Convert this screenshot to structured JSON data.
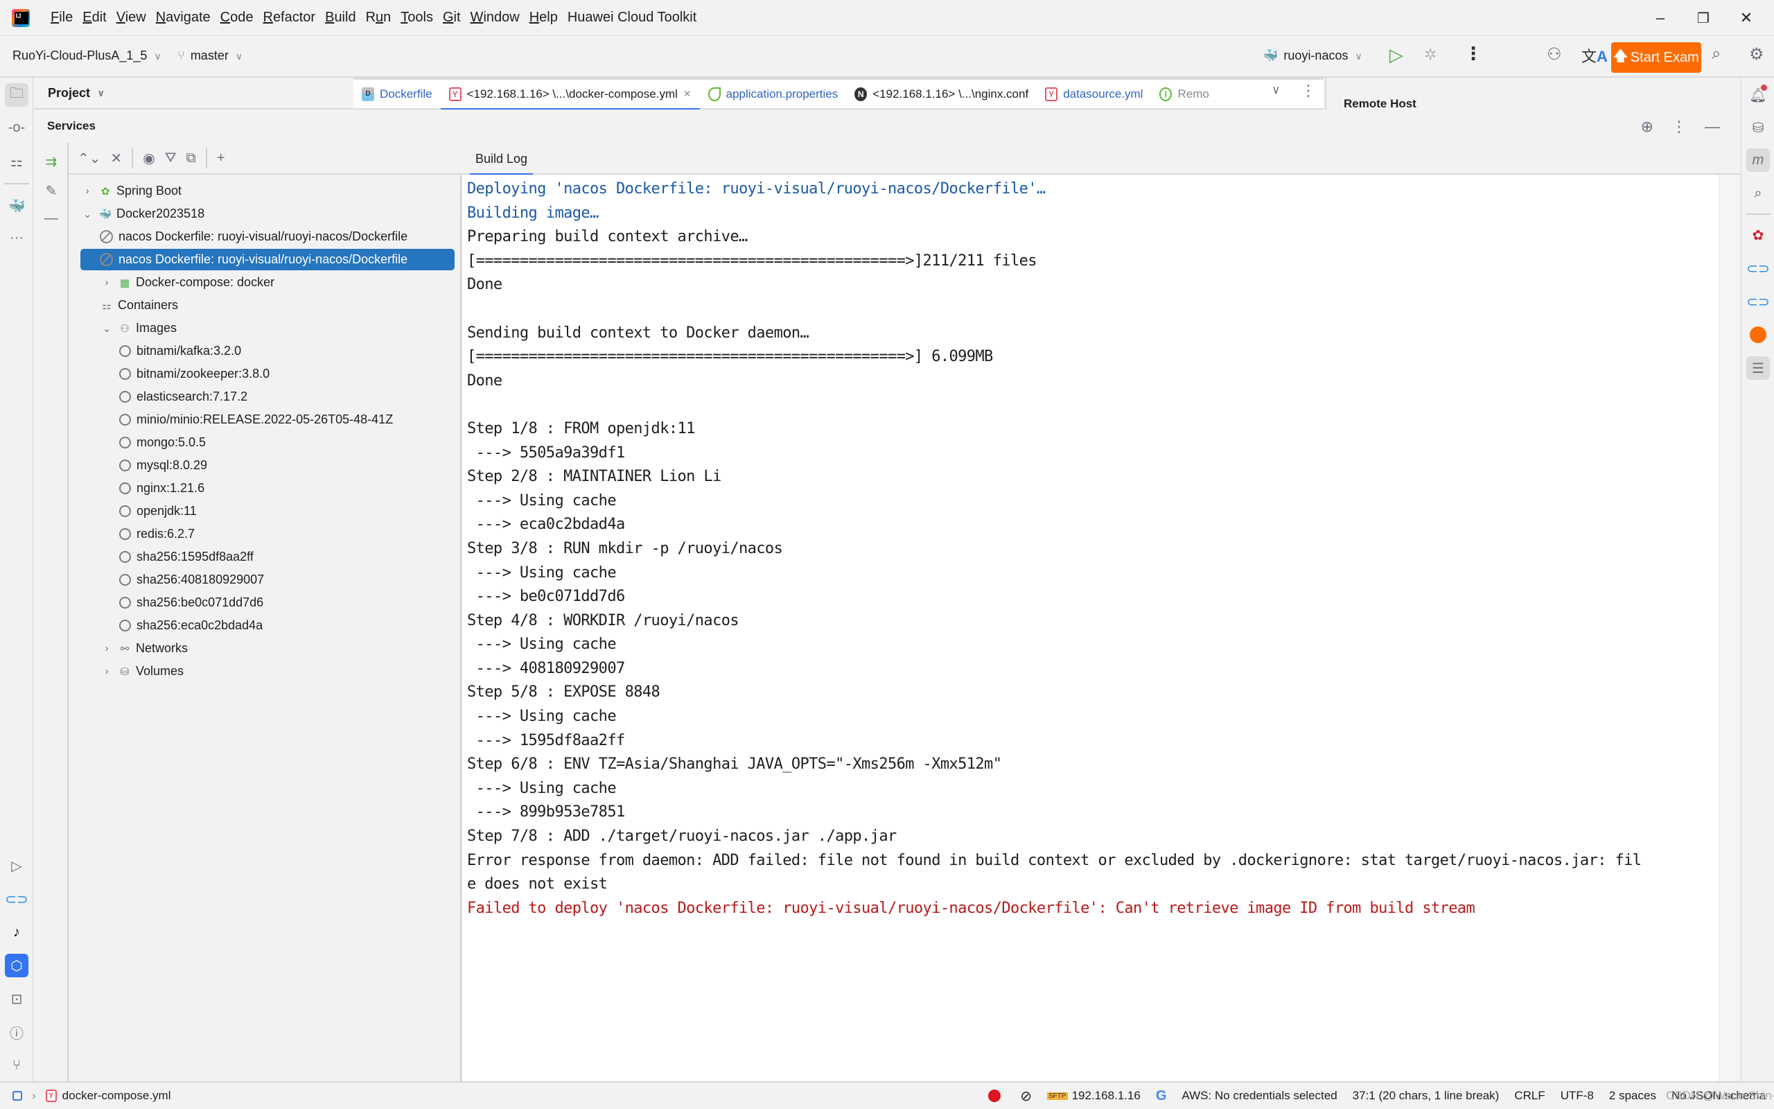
{
  "menu": {
    "items": [
      {
        "label": "File",
        "mnemonic": "F",
        "rest": "ile"
      },
      {
        "label": "Edit",
        "mnemonic": "E",
        "rest": "dit"
      },
      {
        "label": "View",
        "mnemonic": "V",
        "rest": "iew"
      },
      {
        "label": "Navigate",
        "mnemonic": "N",
        "rest": "avigate"
      },
      {
        "label": "Code",
        "mnemonic": "C",
        "rest": "ode"
      },
      {
        "label": "Refactor",
        "mnemonic": "R",
        "rest": "efactor"
      },
      {
        "label": "Build",
        "mnemonic": "B",
        "rest": "uild"
      },
      {
        "label": "Run",
        "mnemonic": "R",
        "rest": "un",
        "pre": "R",
        "u": "u",
        "post": "n"
      },
      {
        "label": "Tools",
        "mnemonic": "T",
        "rest": "ools"
      },
      {
        "label": "Git",
        "mnemonic": "G",
        "rest": "it"
      },
      {
        "label": "Window",
        "mnemonic": "W",
        "rest": "indow"
      },
      {
        "label": "Help",
        "mnemonic": "H",
        "rest": "elp"
      },
      {
        "label": "Huawei Cloud Toolkit",
        "mnemonic": "",
        "rest": "Huawei Cloud Toolkit"
      }
    ],
    "window_controls": {
      "minimize": "–",
      "restore": "❐",
      "close": "✕"
    }
  },
  "toolbar": {
    "project_name": "RuoYi-Cloud-PlusA_1_5",
    "branch": "master",
    "run_config": "ruoyi-nacos",
    "start_exam_label": "Start Exam",
    "colors": {
      "start_exam": "#fb6d04",
      "run": "#4fa94d"
    }
  },
  "project_panel": {
    "title": "Project"
  },
  "editor_tabs": [
    {
      "label": "Dockerfile",
      "icon": "dockerfile-icon",
      "active": false
    },
    {
      "label": "<192.168.1.16> \\...\\docker-compose.yml",
      "icon": "yaml-icon",
      "active": true,
      "closable": true
    },
    {
      "label": "application.properties",
      "icon": "spring-icon",
      "active": false
    },
    {
      "label": "<192.168.1.16> \\...\\nginx.conf",
      "icon": "nginx-icon",
      "active": false
    },
    {
      "label": "datasource.yml",
      "icon": "yaml-icon",
      "active": false
    },
    {
      "label": "Remo",
      "icon": "remote-icon",
      "active": false
    }
  ],
  "remote_host_panel": {
    "title": "Remote Host"
  },
  "services": {
    "title": "Services",
    "log_tab": "Build Log",
    "tree": [
      {
        "label": "Spring Boot",
        "level": 0,
        "expand": "collapsed",
        "icon": "spring-boot-icon"
      },
      {
        "label": "Docker2023518",
        "level": 0,
        "expand": "expanded",
        "icon": "docker-icon"
      },
      {
        "label": "nacos Dockerfile: ruoyi-visual/ruoyi-nacos/Dockerfile",
        "level": 1,
        "expand": "none",
        "icon": "stopped-icon"
      },
      {
        "label": "nacos Dockerfile: ruoyi-visual/ruoyi-nacos/Dockerfile",
        "level": 1,
        "expand": "none",
        "icon": "stopped-icon",
        "selected": true
      },
      {
        "label": "Docker-compose: docker",
        "level": 1,
        "expand": "collapsed",
        "icon": "compose-icon"
      },
      {
        "label": "Containers",
        "level": 1,
        "expand": "none",
        "icon": "containers-icon"
      },
      {
        "label": "Images",
        "level": 1,
        "expand": "expanded",
        "icon": "images-icon"
      },
      {
        "label": "bitnami/kafka:3.2.0",
        "level": 2,
        "expand": "none",
        "icon": "image-icon"
      },
      {
        "label": "bitnami/zookeeper:3.8.0",
        "level": 2,
        "expand": "none",
        "icon": "image-icon"
      },
      {
        "label": "elasticsearch:7.17.2",
        "level": 2,
        "expand": "none",
        "icon": "image-icon"
      },
      {
        "label": "minio/minio:RELEASE.2022-05-26T05-48-41Z",
        "level": 2,
        "expand": "none",
        "icon": "image-icon"
      },
      {
        "label": "mongo:5.0.5",
        "level": 2,
        "expand": "none",
        "icon": "image-icon"
      },
      {
        "label": "mysql:8.0.29",
        "level": 2,
        "expand": "none",
        "icon": "image-icon"
      },
      {
        "label": "nginx:1.21.6",
        "level": 2,
        "expand": "none",
        "icon": "image-icon"
      },
      {
        "label": "openjdk:11",
        "level": 2,
        "expand": "none",
        "icon": "image-icon"
      },
      {
        "label": "redis:6.2.7",
        "level": 2,
        "expand": "none",
        "icon": "image-icon"
      },
      {
        "label": "sha256:1595df8aa2ff",
        "level": 2,
        "expand": "none",
        "icon": "image-icon"
      },
      {
        "label": "sha256:408180929007",
        "level": 2,
        "expand": "none",
        "icon": "image-icon"
      },
      {
        "label": "sha256:be0c071dd7d6",
        "level": 2,
        "expand": "none",
        "icon": "image-icon"
      },
      {
        "label": "sha256:eca0c2bdad4a",
        "level": 2,
        "expand": "none",
        "icon": "image-icon"
      },
      {
        "label": "Networks",
        "level": 1,
        "expand": "collapsed",
        "icon": "networks-icon"
      },
      {
        "label": "Volumes",
        "level": 1,
        "expand": "collapsed",
        "icon": "volumes-icon"
      }
    ]
  },
  "build_log": [
    {
      "text": "Deploying 'nacos Dockerfile: ruoyi-visual/ruoyi-nacos/Dockerfile'…",
      "kind": "info"
    },
    {
      "text": "Building image…",
      "kind": "info"
    },
    {
      "text": "Preparing build context archive…",
      "kind": "normal"
    },
    {
      "text": "[=================================================>]211/211 files",
      "kind": "normal"
    },
    {
      "text": "Done",
      "kind": "normal"
    },
    {
      "text": "",
      "kind": "normal"
    },
    {
      "text": "Sending build context to Docker daemon…",
      "kind": "normal"
    },
    {
      "text": "[=================================================>] 6.099MB",
      "kind": "normal"
    },
    {
      "text": "Done",
      "kind": "normal"
    },
    {
      "text": "",
      "kind": "normal"
    },
    {
      "text": "Step 1/8 : FROM openjdk:11",
      "kind": "normal"
    },
    {
      "text": " ---> 5505a9a39df1",
      "kind": "normal"
    },
    {
      "text": "Step 2/8 : MAINTAINER Lion Li",
      "kind": "normal"
    },
    {
      "text": " ---> Using cache",
      "kind": "normal"
    },
    {
      "text": " ---> eca0c2bdad4a",
      "kind": "normal"
    },
    {
      "text": "Step 3/8 : RUN mkdir -p /ruoyi/nacos",
      "kind": "normal"
    },
    {
      "text": " ---> Using cache",
      "kind": "normal"
    },
    {
      "text": " ---> be0c071dd7d6",
      "kind": "normal"
    },
    {
      "text": "Step 4/8 : WORKDIR /ruoyi/nacos",
      "kind": "normal"
    },
    {
      "text": " ---> Using cache",
      "kind": "normal"
    },
    {
      "text": " ---> 408180929007",
      "kind": "normal"
    },
    {
      "text": "Step 5/8 : EXPOSE 8848",
      "kind": "normal"
    },
    {
      "text": " ---> Using cache",
      "kind": "normal"
    },
    {
      "text": " ---> 1595df8aa2ff",
      "kind": "normal"
    },
    {
      "text": "Step 6/8 : ENV TZ=Asia/Shanghai JAVA_OPTS=\"-Xms256m -Xmx512m\"",
      "kind": "normal"
    },
    {
      "text": " ---> Using cache",
      "kind": "normal"
    },
    {
      "text": " ---> 899b953e7851",
      "kind": "normal"
    },
    {
      "text": "Step 7/8 : ADD ./target/ruoyi-nacos.jar ./app.jar",
      "kind": "normal"
    },
    {
      "text": "Error response from daemon: ADD failed: file not found in build context or excluded by .dockerignore: stat target/ruoyi-nacos.jar: fil",
      "kind": "normal"
    },
    {
      "text": "e does not exist",
      "kind": "normal"
    },
    {
      "text": "Failed to deploy 'nacos Dockerfile: ruoyi-visual/ruoyi-nacos/Dockerfile': Can't retrieve image ID from build stream",
      "kind": "error"
    }
  ],
  "log_colors": {
    "info": "#1a5aa6",
    "normal": "#1e1e1e",
    "error": "#b81a1a"
  },
  "statusbar": {
    "breadcrumb_file": "docker-compose.yml",
    "sftp_host": "192.168.1.16",
    "aws": "AWS: No credentials selected",
    "cursor": "37:1 (20 chars, 1 line break)",
    "line_ending": "CRLF",
    "encoding": "UTF-8",
    "indent": "2 spaces",
    "schema": "No JSON schema",
    "watermark": "CSDN @Wade Shin-lih"
  }
}
